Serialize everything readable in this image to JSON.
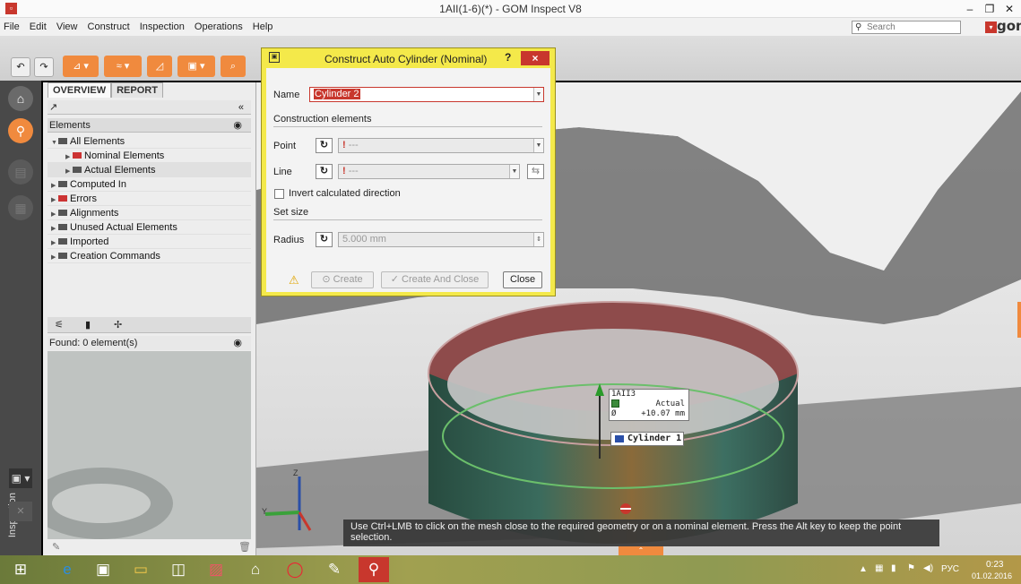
{
  "window": {
    "title": "1AII(1-6)(*) - GOM Inspect V8",
    "app_icon": "gom-app-icon",
    "minimize": "–",
    "maximize": "❐",
    "close": "✕"
  },
  "menu": {
    "items": [
      "File",
      "Edit",
      "View",
      "Construct",
      "Inspection",
      "Operations",
      "Help"
    ],
    "search_placeholder": "Search",
    "logo": "gom"
  },
  "panel": {
    "tabs": [
      "OVERVIEW",
      "REPORT"
    ],
    "collapse": "«",
    "header": "Elements",
    "tree": [
      {
        "label": "All Elements",
        "expanded": true,
        "level": 0
      },
      {
        "label": "Nominal Elements",
        "level": 1,
        "red": true
      },
      {
        "label": "Actual Elements",
        "level": 1,
        "selected": true
      },
      {
        "label": "Computed In",
        "level": 0
      },
      {
        "label": "Errors",
        "level": 0,
        "red": true
      },
      {
        "label": "Alignments",
        "level": 0
      },
      {
        "label": "Unused Actual Elements",
        "level": 0
      },
      {
        "label": "Imported",
        "level": 0
      },
      {
        "label": "Creation Commands",
        "level": 0
      }
    ],
    "found": "Found: 0 element(s)",
    "side_tab": "Inspection"
  },
  "dialog": {
    "title": "Construct Auto Cylinder (Nominal)",
    "help": "?",
    "close": "×",
    "name_label": "Name",
    "name_value": "Cylinder 2",
    "section_construction": "Construction elements",
    "point_label": "Point",
    "point_value": "---",
    "line_label": "Line",
    "line_value": "---",
    "invert_label": "Invert calculated direction",
    "section_size": "Set size",
    "radius_label": "Radius",
    "radius_value": "5.000 mm",
    "create": "Create",
    "create_and_close": "Create And Close",
    "close_btn": "Close"
  },
  "viewport": {
    "label": {
      "name": "1AII3",
      "actual_label": "Actual",
      "diameter_symbol": "Ø",
      "diameter_value": "+10.07 mm",
      "cylinder": "Cylinder 1"
    },
    "axes": {
      "z": "Z",
      "y": "Y"
    },
    "tip": "Use Ctrl+LMB to click on the mesh close to the required geometry or on a nominal element. Press the Alt key to keep the point selection."
  },
  "taskbar": {
    "tray_lang": "РУС",
    "time": "0:23",
    "date": "01.02.2016"
  },
  "colors": {
    "accent": "#f08a3e",
    "dialog_frame": "#f4e94a",
    "close_red": "#c8372d"
  }
}
